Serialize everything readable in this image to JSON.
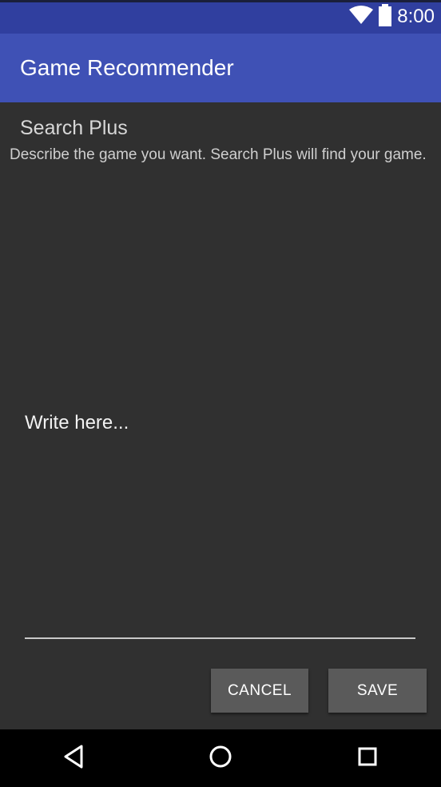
{
  "status_bar": {
    "time": "8:00",
    "icons": [
      "wifi-icon",
      "battery-icon"
    ],
    "color": "#303f9f"
  },
  "app_bar": {
    "title": "Game Recommender",
    "color": "#3f51b5"
  },
  "search_plus": {
    "title": "Search Plus",
    "description": "Describe the game you want. Search Plus will find your game.",
    "input_placeholder": "Write here..."
  },
  "buttons": {
    "cancel_label": "CANCEL",
    "save_label": "SAVE"
  },
  "nav_bar": {
    "icons": [
      "back-icon",
      "home-icon",
      "recents-icon"
    ]
  }
}
